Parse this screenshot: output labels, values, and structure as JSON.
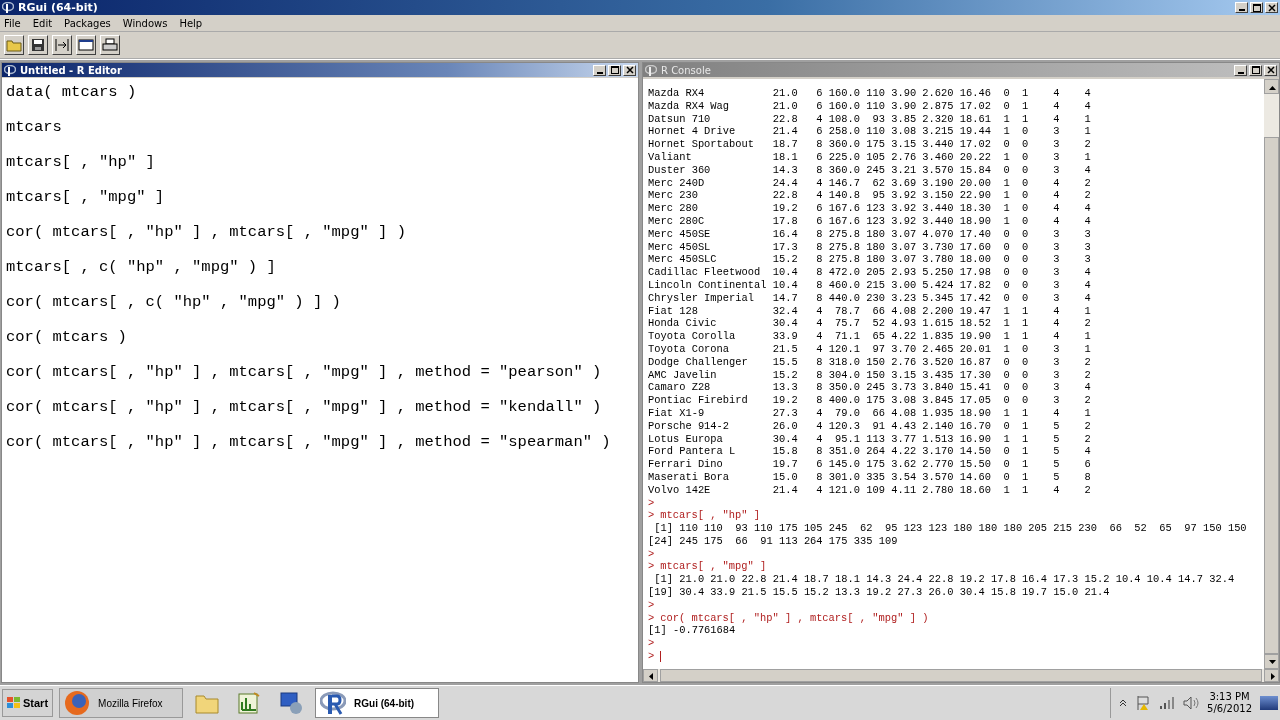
{
  "window": {
    "title": "RGui (64-bit)"
  },
  "menu": [
    "File",
    "Edit",
    "Packages",
    "Windows",
    "Help"
  ],
  "editor": {
    "title": "Untitled - R Editor",
    "lines": [
      "data( mtcars )",
      "mtcars",
      "mtcars[ , \"hp\" ]",
      "mtcars[ , \"mpg\" ]",
      "cor( mtcars[ , \"hp\" ] , mtcars[ , \"mpg\" ] )",
      "mtcars[ , c( \"hp\" , \"mpg\" ) ]",
      "cor( mtcars[ , c( \"hp\" , \"mpg\" ) ] )",
      "cor( mtcars )",
      "cor( mtcars[ , \"hp\" ] , mtcars[ , \"mpg\" ] , method = \"pearson\" )",
      "cor( mtcars[ , \"hp\" ] , mtcars[ , \"mpg\" ] , method = \"kendall\" )",
      "cor( mtcars[ , \"hp\" ] , mtcars[ , \"mpg\" ] , method = \"spearman\" )"
    ]
  },
  "console": {
    "title": "R Console",
    "lines": [
      {
        "kind": "out",
        "text": "Mazda RX4           21.0   6 160.0 110 3.90 2.620 16.46  0  1    4    4"
      },
      {
        "kind": "out",
        "text": "Mazda RX4 Wag       21.0   6 160.0 110 3.90 2.875 17.02  0  1    4    4"
      },
      {
        "kind": "out",
        "text": "Datsun 710          22.8   4 108.0  93 3.85 2.320 18.61  1  1    4    1"
      },
      {
        "kind": "out",
        "text": "Hornet 4 Drive      21.4   6 258.0 110 3.08 3.215 19.44  1  0    3    1"
      },
      {
        "kind": "out",
        "text": "Hornet Sportabout   18.7   8 360.0 175 3.15 3.440 17.02  0  0    3    2"
      },
      {
        "kind": "out",
        "text": "Valiant             18.1   6 225.0 105 2.76 3.460 20.22  1  0    3    1"
      },
      {
        "kind": "out",
        "text": "Duster 360          14.3   8 360.0 245 3.21 3.570 15.84  0  0    3    4"
      },
      {
        "kind": "out",
        "text": "Merc 240D           24.4   4 146.7  62 3.69 3.190 20.00  1  0    4    2"
      },
      {
        "kind": "out",
        "text": "Merc 230            22.8   4 140.8  95 3.92 3.150 22.90  1  0    4    2"
      },
      {
        "kind": "out",
        "text": "Merc 280            19.2   6 167.6 123 3.92 3.440 18.30  1  0    4    4"
      },
      {
        "kind": "out",
        "text": "Merc 280C           17.8   6 167.6 123 3.92 3.440 18.90  1  0    4    4"
      },
      {
        "kind": "out",
        "text": "Merc 450SE          16.4   8 275.8 180 3.07 4.070 17.40  0  0    3    3"
      },
      {
        "kind": "out",
        "text": "Merc 450SL          17.3   8 275.8 180 3.07 3.730 17.60  0  0    3    3"
      },
      {
        "kind": "out",
        "text": "Merc 450SLC         15.2   8 275.8 180 3.07 3.780 18.00  0  0    3    3"
      },
      {
        "kind": "out",
        "text": "Cadillac Fleetwood  10.4   8 472.0 205 2.93 5.250 17.98  0  0    3    4"
      },
      {
        "kind": "out",
        "text": "Lincoln Continental 10.4   8 460.0 215 3.00 5.424 17.82  0  0    3    4"
      },
      {
        "kind": "out",
        "text": "Chrysler Imperial   14.7   8 440.0 230 3.23 5.345 17.42  0  0    3    4"
      },
      {
        "kind": "out",
        "text": "Fiat 128            32.4   4  78.7  66 4.08 2.200 19.47  1  1    4    1"
      },
      {
        "kind": "out",
        "text": "Honda Civic         30.4   4  75.7  52 4.93 1.615 18.52  1  1    4    2"
      },
      {
        "kind": "out",
        "text": "Toyota Corolla      33.9   4  71.1  65 4.22 1.835 19.90  1  1    4    1"
      },
      {
        "kind": "out",
        "text": "Toyota Corona       21.5   4 120.1  97 3.70 2.465 20.01  1  0    3    1"
      },
      {
        "kind": "out",
        "text": "Dodge Challenger    15.5   8 318.0 150 2.76 3.520 16.87  0  0    3    2"
      },
      {
        "kind": "out",
        "text": "AMC Javelin         15.2   8 304.0 150 3.15 3.435 17.30  0  0    3    2"
      },
      {
        "kind": "out",
        "text": "Camaro Z28          13.3   8 350.0 245 3.73 3.840 15.41  0  0    3    4"
      },
      {
        "kind": "out",
        "text": "Pontiac Firebird    19.2   8 400.0 175 3.08 3.845 17.05  0  0    3    2"
      },
      {
        "kind": "out",
        "text": "Fiat X1-9           27.3   4  79.0  66 4.08 1.935 18.90  1  1    4    1"
      },
      {
        "kind": "out",
        "text": "Porsche 914-2       26.0   4 120.3  91 4.43 2.140 16.70  0  1    5    2"
      },
      {
        "kind": "out",
        "text": "Lotus Europa        30.4   4  95.1 113 3.77 1.513 16.90  1  1    5    2"
      },
      {
        "kind": "out",
        "text": "Ford Pantera L      15.8   8 351.0 264 4.22 3.170 14.50  0  1    5    4"
      },
      {
        "kind": "out",
        "text": "Ferrari Dino        19.7   6 145.0 175 3.62 2.770 15.50  0  1    5    6"
      },
      {
        "kind": "out",
        "text": "Maserati Bora       15.0   8 301.0 335 3.54 3.570 14.60  0  1    5    8"
      },
      {
        "kind": "out",
        "text": "Volvo 142E          21.4   4 121.0 109 4.11 2.780 18.60  1  1    4    2"
      },
      {
        "kind": "cmd",
        "prompt": ">"
      },
      {
        "kind": "cmd",
        "prompt": ">",
        "text": "mtcars[ , \"hp\" ]"
      },
      {
        "kind": "out",
        "text": " [1] 110 110  93 110 175 105 245  62  95 123 123 180 180 180 205 215 230  66  52  65  97 150 150"
      },
      {
        "kind": "out",
        "text": "[24] 245 175  66  91 113 264 175 335 109"
      },
      {
        "kind": "cmd",
        "prompt": ">"
      },
      {
        "kind": "cmd",
        "prompt": ">",
        "text": "mtcars[ , \"mpg\" ]"
      },
      {
        "kind": "out",
        "text": " [1] 21.0 21.0 22.8 21.4 18.7 18.1 14.3 24.4 22.8 19.2 17.8 16.4 17.3 15.2 10.4 10.4 14.7 32.4"
      },
      {
        "kind": "out",
        "text": "[19] 30.4 33.9 21.5 15.5 15.2 13.3 19.2 27.3 26.0 30.4 15.8 19.7 15.0 21.4"
      },
      {
        "kind": "cmd",
        "prompt": ">"
      },
      {
        "kind": "cmd",
        "prompt": ">",
        "text": "cor( mtcars[ , \"hp\" ] , mtcars[ , \"mpg\" ] )"
      },
      {
        "kind": "out",
        "text": "[1] -0.7761684"
      },
      {
        "kind": "cmd",
        "prompt": ">"
      },
      {
        "kind": "cursor",
        "prompt": ">"
      }
    ]
  },
  "taskbar": {
    "start": "Start",
    "tasks": [
      {
        "kind": "task",
        "label": "Mozilla Firefox",
        "selected": false
      },
      {
        "kind": "folder"
      },
      {
        "kind": "chart"
      },
      {
        "kind": "network"
      },
      {
        "kind": "task",
        "label": "RGui (64-bit)",
        "selected": true
      }
    ],
    "time": "3:13 PM",
    "date": "5/6/2012"
  }
}
